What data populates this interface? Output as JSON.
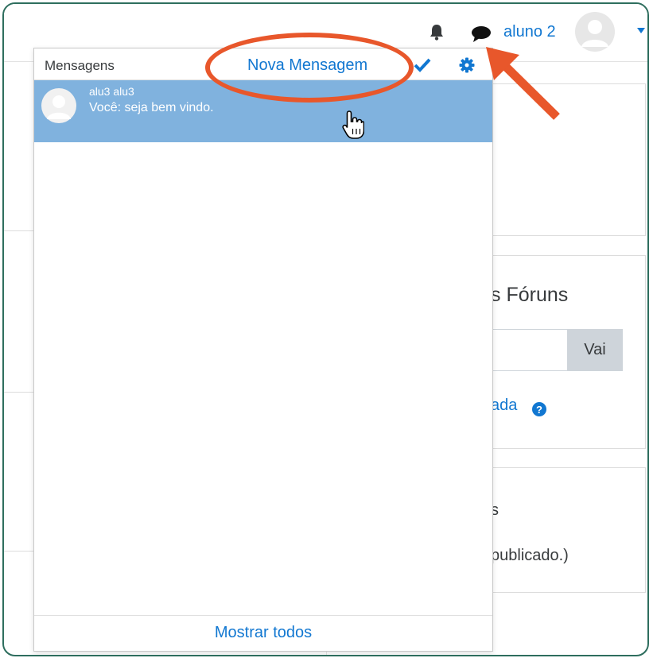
{
  "navbar": {
    "user_name": "aluno 2",
    "icons": [
      "bell-icon",
      "chat-icon",
      "avatar",
      "caret-down-icon"
    ]
  },
  "messages_popover": {
    "title": "Mensagens",
    "new_message_label": "Nova Mensagem",
    "conversations": [
      {
        "sender": "alu3 alu3",
        "preview": "Você: seja bem vindo."
      }
    ],
    "show_all_label": "Mostrar todos"
  },
  "background_page": {
    "forum_title_partial": "s Fóruns",
    "go_button": "Vai",
    "advanced_partial": "ada",
    "card3_line1_partial": "s",
    "card3_line2_partial": "publicado.)"
  },
  "colors": {
    "link_blue": "#1177d1",
    "selected_row": "#80b2de",
    "annotation_orange": "#e8572b",
    "frame_border": "#2e6e5e"
  }
}
